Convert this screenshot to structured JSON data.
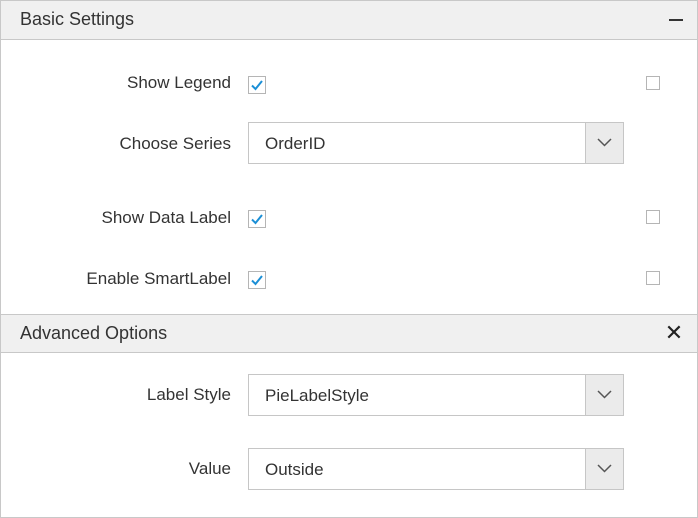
{
  "basic_settings": {
    "title": "Basic Settings",
    "show_legend": {
      "label": "Show Legend",
      "checked": true
    },
    "choose_series": {
      "label": "Choose Series",
      "value": "OrderID"
    },
    "show_data_label": {
      "label": "Show Data Label",
      "checked": true
    },
    "enable_smart_label": {
      "label": "Enable SmartLabel",
      "checked": true
    }
  },
  "advanced_options": {
    "title": "Advanced Options",
    "label_style": {
      "label": "Label Style",
      "value": "PieLabelStyle"
    },
    "value": {
      "label": "Value",
      "value": "Outside"
    }
  },
  "colors": {
    "check": "#1b8fd6",
    "header_bg": "#f0f0f0",
    "border": "#c8c8c8"
  },
  "icons": {
    "collapse": "minus-icon",
    "close": "close-icon",
    "dropdown": "chevron-down-icon",
    "check": "checkmark-icon"
  }
}
